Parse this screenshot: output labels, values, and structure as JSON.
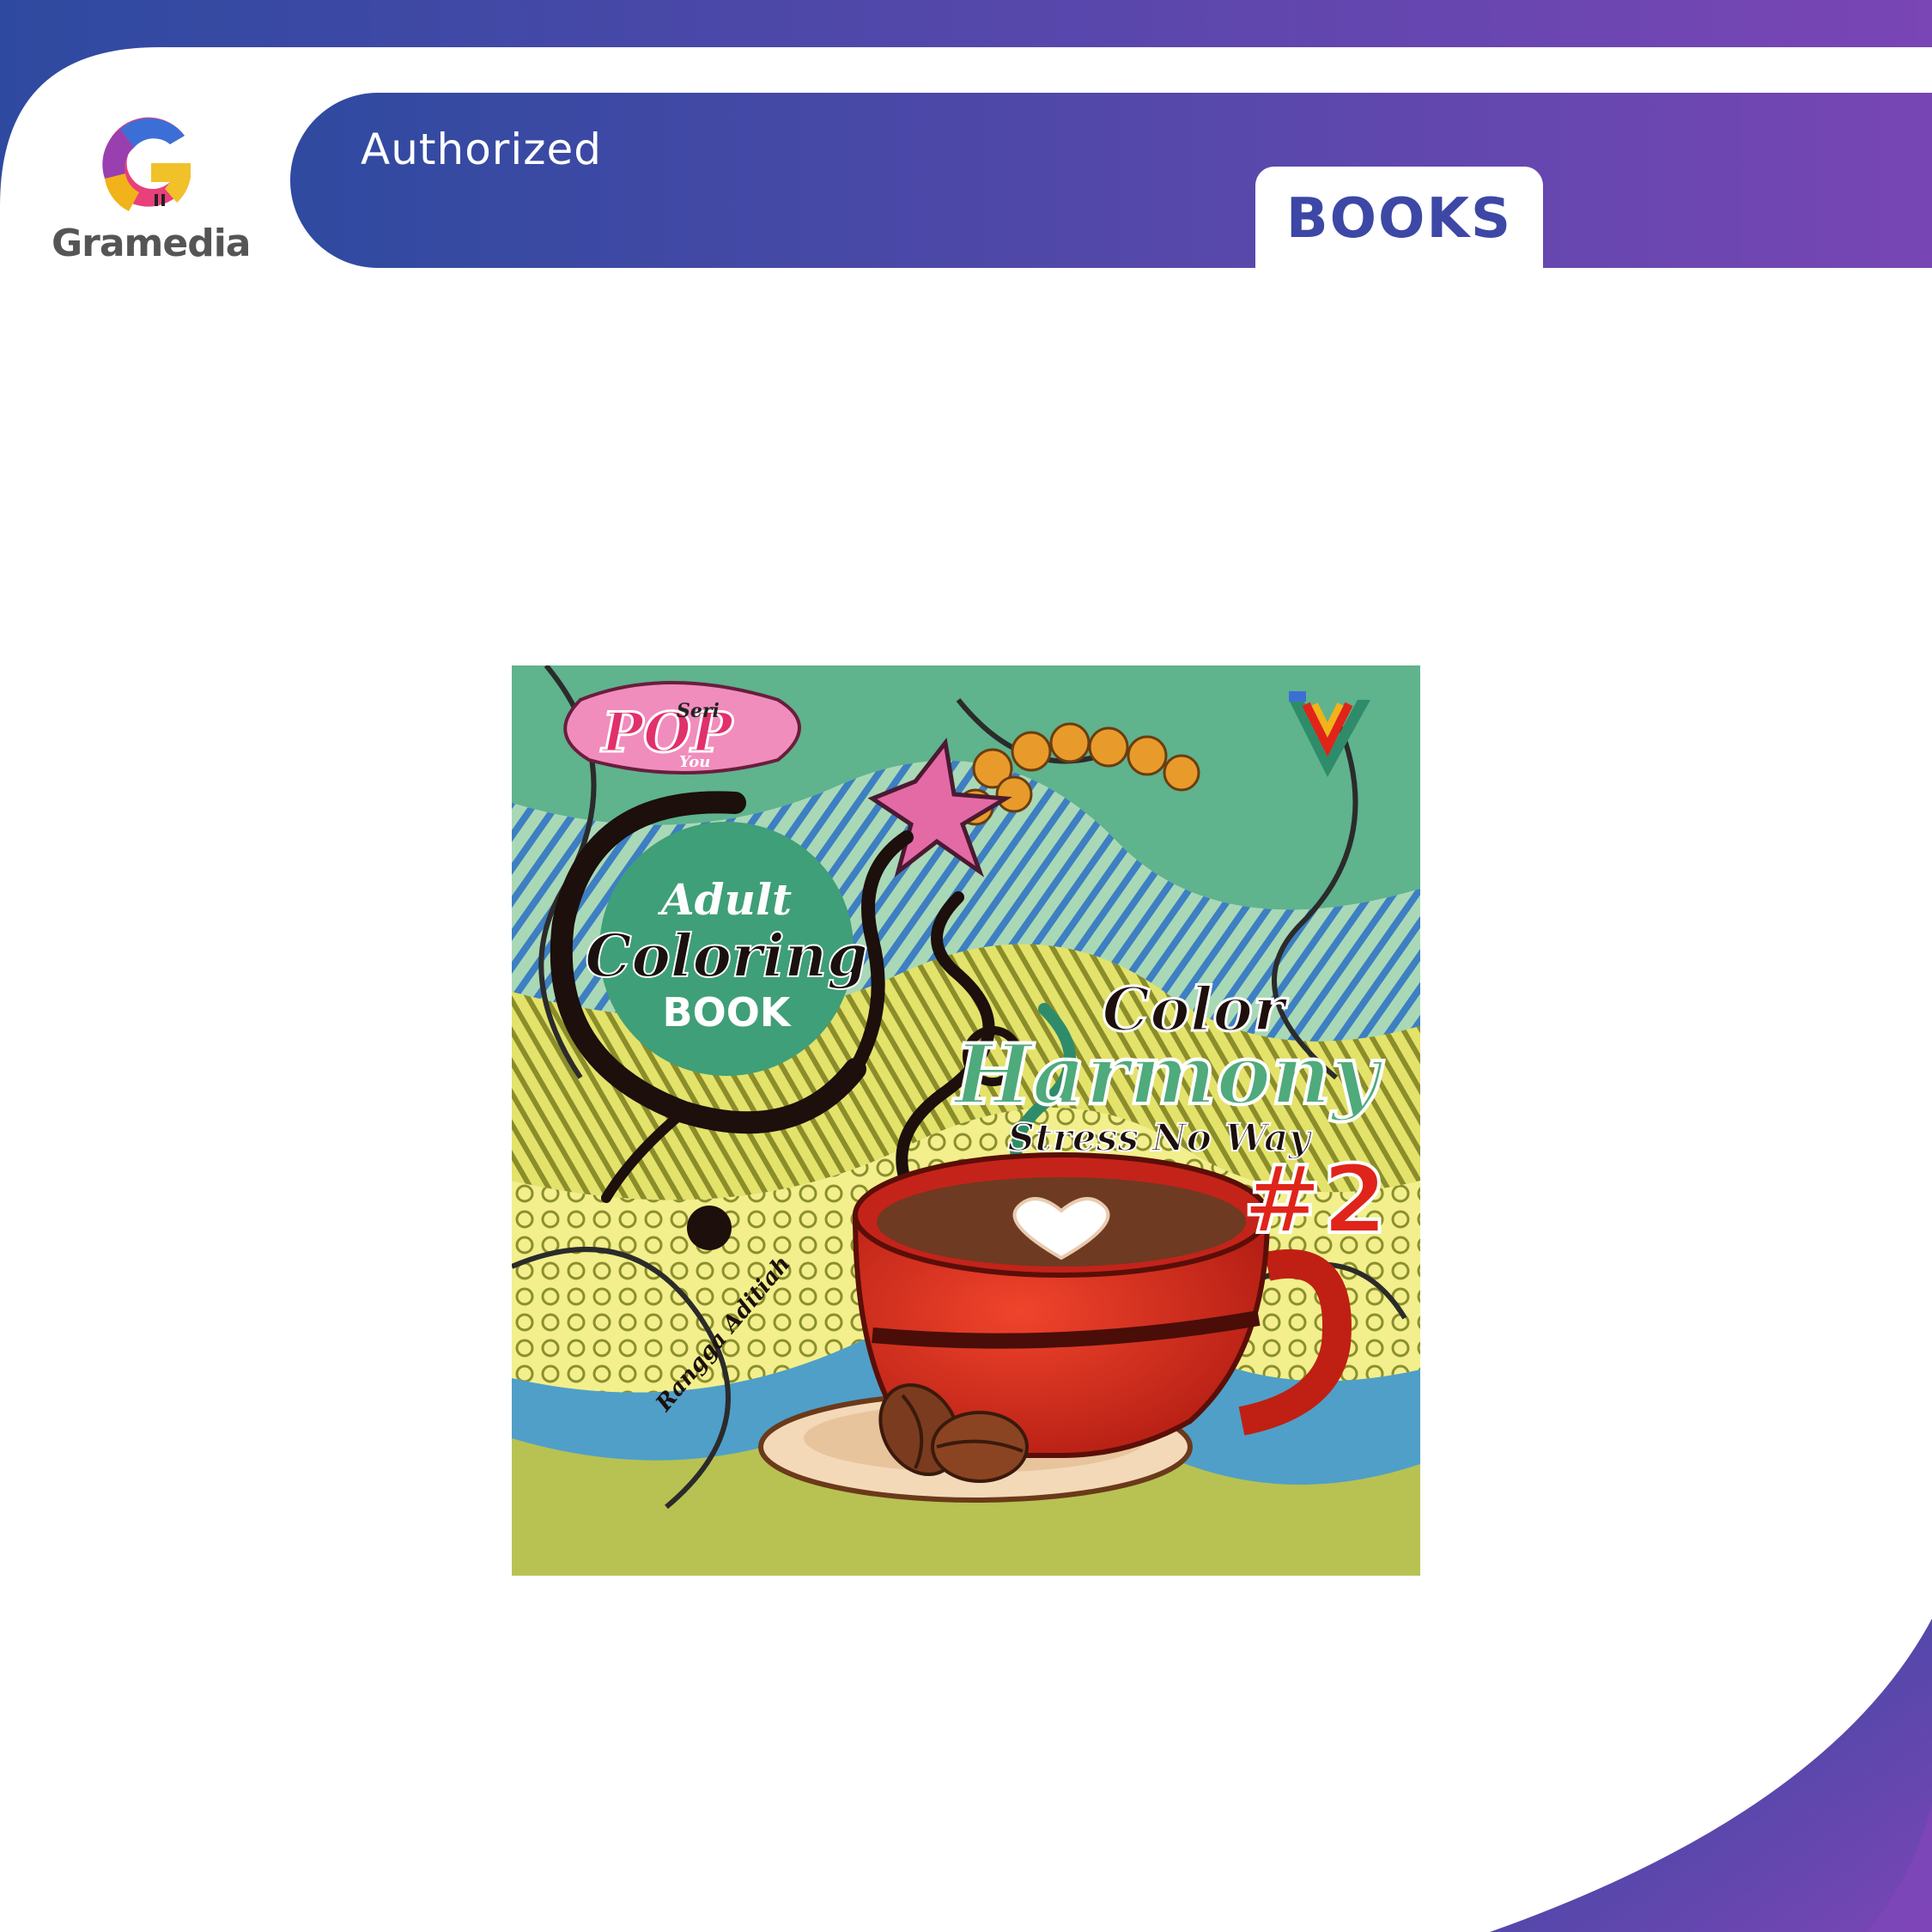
{
  "brand": {
    "name": "Gramedia",
    "logo_icon": "gramedia-g-logo",
    "colors": {
      "gradient_start": "#2e4aa0",
      "gradient_end": "#7a45b5",
      "books_text": "#3d47a5"
    }
  },
  "banner": {
    "authorized_label": "Authorized",
    "category_label": "BOOKS"
  },
  "product": {
    "cover": {
      "series_label": "Seri",
      "series_name": "POP",
      "series_tag": "You",
      "badge_line1": "Adult",
      "badge_line2": "Coloring",
      "badge_line3": "BOOK",
      "title_line1": "Color",
      "title_line2": "Harmony",
      "subtitle": "Stress No Way",
      "volume": "#2",
      "illustrator_signature": "Rangga Aditiah",
      "publisher_icon": "publisher-v-logo",
      "illustration": "coffee-cup-icon"
    }
  }
}
